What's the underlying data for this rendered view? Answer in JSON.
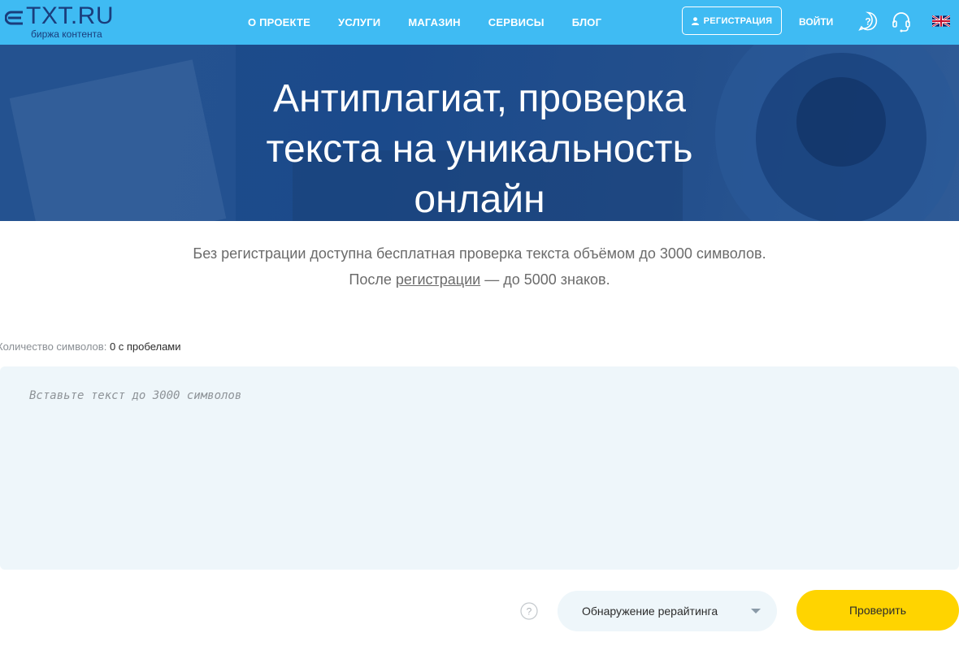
{
  "header": {
    "logo_text": "TXT.RU",
    "logo_subtitle": "биржа контента",
    "nav": [
      {
        "label": "О ПРОЕКТЕ"
      },
      {
        "label": "УСЛУГИ"
      },
      {
        "label": "МАГАЗИН"
      },
      {
        "label": "СЕРВИСЫ"
      },
      {
        "label": "БЛОГ"
      }
    ],
    "register_label": "РЕГИСТРАЦИЯ",
    "login_label": "ВОЙТИ",
    "icons": [
      "help-icon",
      "headset-icon",
      "uk-flag-icon"
    ]
  },
  "hero": {
    "title": "Антиплагиат, проверка текста на уникальность онлайн"
  },
  "intro": {
    "line1": "Без регистрации доступна бесплатная проверка текста объёмом до 3000 символов.",
    "line2_before": "После ",
    "line2_link": "регистрации",
    "line2_after": " — до 5000 знаков."
  },
  "counter": {
    "label": "Количество символов:",
    "value": "0 с пробелами"
  },
  "editor": {
    "placeholder": "Вставьте текст до 3000 символов",
    "value": ""
  },
  "controls": {
    "mode_selected": "Обнаружение рерайтинга",
    "check_label": "Проверить"
  },
  "colors": {
    "header_bg": "#3fbbf3",
    "hero_bg": "#1e4d8a",
    "accent_button": "#ffd400",
    "field_bg": "#eef6fa"
  }
}
